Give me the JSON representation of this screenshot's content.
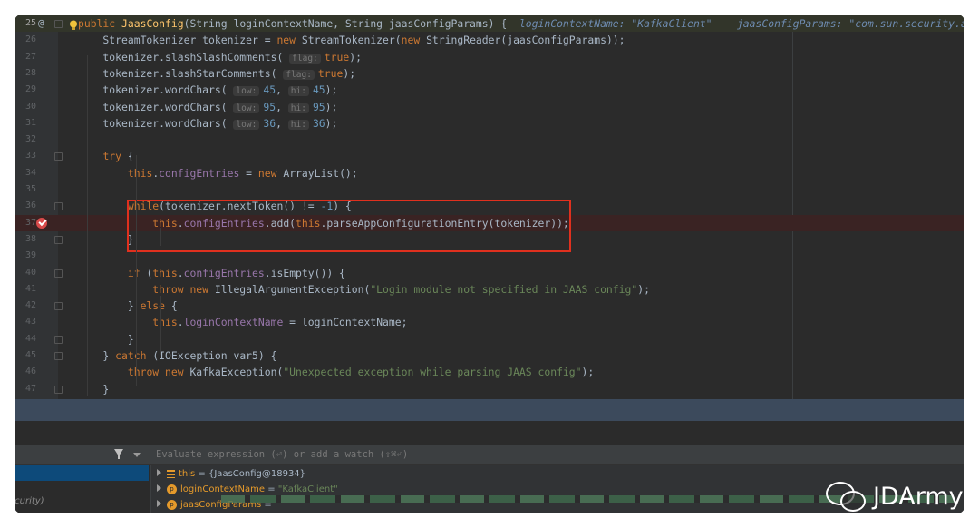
{
  "editor": {
    "lines": [
      {
        "n": "25",
        "segs": [
          [
            "kw",
            "public "
          ],
          [
            "fn",
            "JaasConfig"
          ],
          [
            "p",
            "(String loginContextName, String jaasConfigParams) {  "
          ],
          [
            "inl",
            "loginContextName: \"KafkaClient\"    jaasConfigParams: \"com.sun.security.au"
          ]
        ]
      },
      {
        "n": "26",
        "segs": [
          [
            "p",
            "    StreamTokenizer tokenizer = "
          ],
          [
            "kw",
            "new "
          ],
          [
            "p",
            "StreamTokenizer("
          ],
          [
            "kw",
            "new "
          ],
          [
            "p",
            "StringReader(jaasConfigParams));"
          ]
        ]
      },
      {
        "n": "27",
        "segs": [
          [
            "p",
            "    tokenizer.slashSlashComments( "
          ],
          [
            "hint",
            "flag:"
          ],
          [
            "kw",
            "true"
          ],
          [
            "p",
            ");"
          ]
        ]
      },
      {
        "n": "28",
        "segs": [
          [
            "p",
            "    tokenizer.slashStarComments( "
          ],
          [
            "hint",
            "flag:"
          ],
          [
            "kw",
            "true"
          ],
          [
            "p",
            ");"
          ]
        ]
      },
      {
        "n": "29",
        "segs": [
          [
            "p",
            "    tokenizer.wordChars( "
          ],
          [
            "hint",
            "low:"
          ],
          [
            "num",
            "45"
          ],
          [
            "p",
            ", "
          ],
          [
            "hint",
            "hi:"
          ],
          [
            "num",
            "45"
          ],
          [
            "p",
            ");"
          ]
        ]
      },
      {
        "n": "30",
        "segs": [
          [
            "p",
            "    tokenizer.wordChars( "
          ],
          [
            "hint",
            "low:"
          ],
          [
            "num",
            "95"
          ],
          [
            "p",
            ", "
          ],
          [
            "hint",
            "hi:"
          ],
          [
            "num",
            "95"
          ],
          [
            "p",
            ");"
          ]
        ]
      },
      {
        "n": "31",
        "segs": [
          [
            "p",
            "    tokenizer.wordChars( "
          ],
          [
            "hint",
            "low:"
          ],
          [
            "num",
            "36"
          ],
          [
            "p",
            ", "
          ],
          [
            "hint",
            "hi:"
          ],
          [
            "num",
            "36"
          ],
          [
            "p",
            ");"
          ]
        ]
      },
      {
        "n": "32",
        "segs": []
      },
      {
        "n": "33",
        "segs": [
          [
            "p",
            "    "
          ],
          [
            "kw",
            "try "
          ],
          [
            "p",
            "{"
          ]
        ]
      },
      {
        "n": "34",
        "segs": [
          [
            "p",
            "        "
          ],
          [
            "kw",
            "this"
          ],
          [
            "p",
            "."
          ],
          [
            "fld",
            "configEntries"
          ],
          [
            "p",
            " = "
          ],
          [
            "kw",
            "new "
          ],
          [
            "p",
            "ArrayList();"
          ]
        ]
      },
      {
        "n": "35",
        "segs": []
      },
      {
        "n": "36",
        "segs": [
          [
            "p",
            "        "
          ],
          [
            "kw",
            "while"
          ],
          [
            "p",
            "(tokenizer.nextToken() != "
          ],
          [
            "num",
            "-1"
          ],
          [
            "p",
            ") {"
          ]
        ]
      },
      {
        "n": "37",
        "segs": [
          [
            "p",
            "            "
          ],
          [
            "kw",
            "this"
          ],
          [
            "p",
            "."
          ],
          [
            "fld",
            "configEntries"
          ],
          [
            "p",
            ".add("
          ],
          [
            "kw",
            "this"
          ],
          [
            "p",
            ".parseAppConfigurationEntry(tokenizer));"
          ]
        ]
      },
      {
        "n": "38",
        "segs": [
          [
            "p",
            "        }"
          ]
        ]
      },
      {
        "n": "39",
        "segs": []
      },
      {
        "n": "40",
        "segs": [
          [
            "p",
            "        "
          ],
          [
            "kw",
            "if "
          ],
          [
            "p",
            "("
          ],
          [
            "kw",
            "this"
          ],
          [
            "p",
            "."
          ],
          [
            "fld",
            "configEntries"
          ],
          [
            "p",
            ".isEmpty()) {"
          ]
        ]
      },
      {
        "n": "41",
        "segs": [
          [
            "p",
            "            "
          ],
          [
            "kw",
            "throw new "
          ],
          [
            "p",
            "IllegalArgumentException("
          ],
          [
            "str",
            "\"Login module not specified in JAAS config\""
          ],
          [
            "p",
            ");"
          ]
        ]
      },
      {
        "n": "42",
        "segs": [
          [
            "p",
            "        } "
          ],
          [
            "kw",
            "else "
          ],
          [
            "p",
            "{"
          ]
        ]
      },
      {
        "n": "43",
        "segs": [
          [
            "p",
            "            "
          ],
          [
            "kw",
            "this"
          ],
          [
            "p",
            "."
          ],
          [
            "fld",
            "loginContextName"
          ],
          [
            "p",
            " = loginContextName;"
          ]
        ]
      },
      {
        "n": "44",
        "segs": [
          [
            "p",
            "        }"
          ]
        ]
      },
      {
        "n": "45",
        "segs": [
          [
            "p",
            "    } "
          ],
          [
            "kw",
            "catch "
          ],
          [
            "p",
            "(IOException var5) {"
          ]
        ]
      },
      {
        "n": "46",
        "segs": [
          [
            "p",
            "        "
          ],
          [
            "kw",
            "throw new "
          ],
          [
            "p",
            "KafkaException("
          ],
          [
            "str",
            "\"Unexpected exception while parsing JAAS config\""
          ],
          [
            "p",
            ");"
          ]
        ]
      },
      {
        "n": "47",
        "segs": [
          [
            "p",
            "    }"
          ]
        ]
      }
    ],
    "first_line_marker": "@"
  },
  "debugger": {
    "eval_placeholder": "Evaluate expression (⏎) or add a watch (⇧⌘⏎)",
    "frame_partial": "ecurity)",
    "vars": [
      {
        "icon": "list",
        "name": "this",
        "eq": " = ",
        "val": "{JaasConfig@18934}",
        "str": false
      },
      {
        "icon": "p",
        "name": "loginContextName",
        "eq": " = ",
        "val": "\"KafkaClient\"",
        "str": true
      },
      {
        "icon": "p",
        "name": "jaasConfigParams",
        "eq": " = ",
        "val": "",
        "str": false
      }
    ]
  },
  "watermark": {
    "text": "JDArmy"
  },
  "colors": {
    "keyword": "#cc7832",
    "function": "#ffc66d",
    "field": "#9876aa",
    "number": "#6897bb",
    "string": "#6a8759",
    "highlight_box": "#e0301e"
  }
}
